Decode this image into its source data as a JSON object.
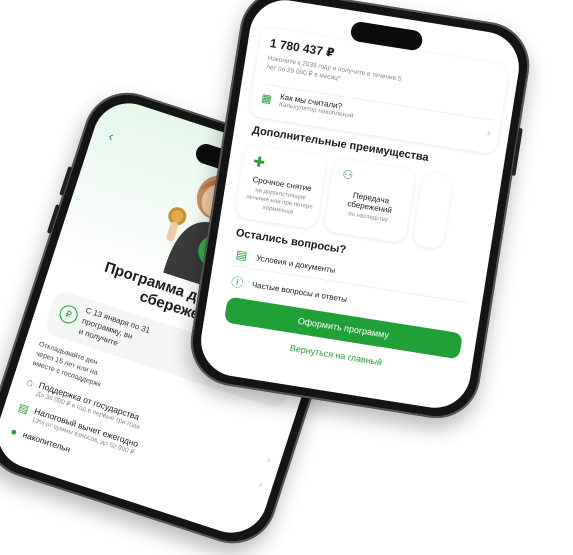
{
  "back_screen": {
    "title_line1": "Программа долгосрочн",
    "title_line2": "сбережений",
    "info_line1": "С 13 января по 31",
    "info_line2": "программу, вн",
    "info_line3": "и получите",
    "desc_line1": "Откладывайте ден",
    "desc_line2": "через 15 лет или на",
    "desc_line3": "вместе с господдержк",
    "benefits": [
      {
        "title": "Поддержка от государства",
        "subtitle": "До 36 000 ₽ в год в первые три года",
        "icon": "bank-icon"
      },
      {
        "title": "Налоговый вычет ежегодно",
        "subtitle": "13% от суммы взносов, до 52 000 ₽",
        "icon": "tax-icon"
      },
      {
        "title": "накопительн",
        "subtitle": "",
        "icon": "piggy-icon"
      }
    ]
  },
  "front_screen": {
    "amount": "1 780 437 ₽",
    "amount_note": "Накопите к 2039 году и получите в течение 5 лет по 29 000 ₽ в месяц*",
    "calc_title": "Как мы считали?",
    "calc_subtitle": "Калькулятор накоплений",
    "advantages_heading": "Дополнительные преимущества",
    "advantages": [
      {
        "title": "Срочное снятие",
        "subtitle": "на дорогостоящее лечение или при потере кормильца",
        "icon": "medical-cross-icon"
      },
      {
        "title": "Передача сбережений",
        "subtitle": "по наследству",
        "icon": "people-icon"
      }
    ],
    "questions_heading": "Остались вопросы?",
    "links": [
      {
        "label": "Условия и документы",
        "icon": "document-icon"
      },
      {
        "label": "Частые вопросы и ответы",
        "icon": "info-icon"
      }
    ],
    "primary_button": "Оформить программу",
    "secondary_link": "Вернуться на главный"
  },
  "colors": {
    "accent": "#21a038",
    "phone_frame": "#141414",
    "back_gradient": "#e6f6ea"
  }
}
